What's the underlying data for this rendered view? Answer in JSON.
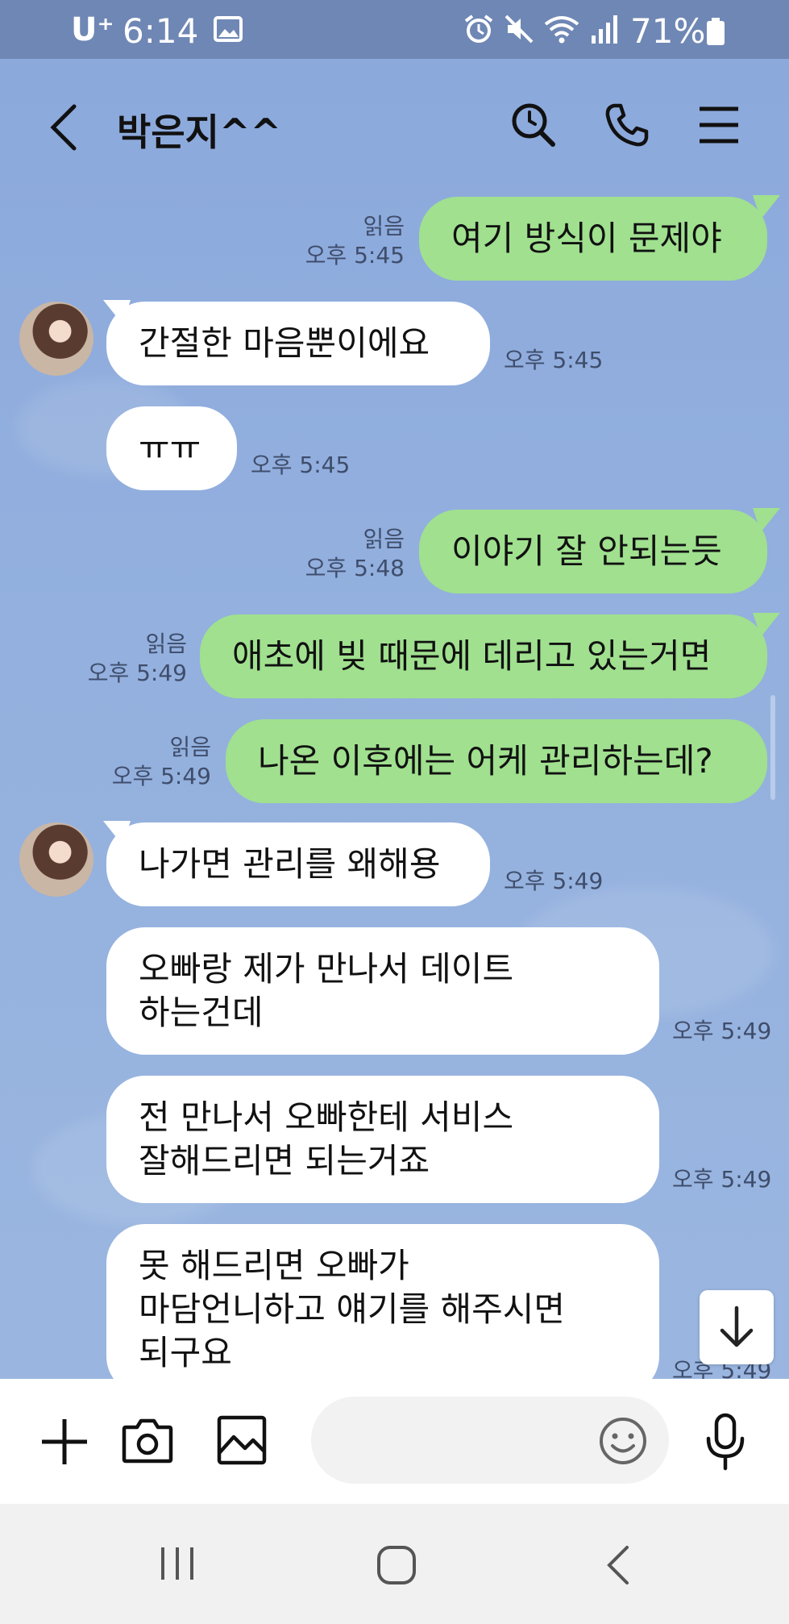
{
  "status_bar": {
    "carrier": "U⁺",
    "time": "6:14",
    "battery": "71%"
  },
  "header": {
    "title": "박은지^^"
  },
  "messages": [
    {
      "dir": "out",
      "text": "여기 방식이 문제야",
      "read": "읽음",
      "time": "오후 5:45"
    },
    {
      "dir": "in",
      "text": "간절한 마음뿐이에요",
      "time": "오후 5:45"
    },
    {
      "dir": "in",
      "text": "ㅠㅠ",
      "time": "오후 5:45"
    },
    {
      "dir": "out",
      "text": "이야기 잘 안되는듯",
      "read": "읽음",
      "time": "오후 5:48"
    },
    {
      "dir": "out",
      "text": "애초에 빚 때문에 데리고 있는거면",
      "read": "읽음",
      "time": "오후 5:49"
    },
    {
      "dir": "out",
      "text": "나온 이후에는 어케 관리하는데?",
      "read": "읽음",
      "time": "오후 5:49"
    },
    {
      "dir": "in",
      "text": "나가면 관리를 왜해용",
      "time": "오후 5:49"
    },
    {
      "dir": "in",
      "line1": "오빠랑 제가 만나서 데이트",
      "line2": "하는건데",
      "time": "오후 5:49"
    },
    {
      "dir": "in",
      "line1": "전 만나서 오빠한테 서비스",
      "line2": "잘해드리면 되는거죠",
      "time": "오후 5:49"
    },
    {
      "dir": "in",
      "line1": "못 해드리면 오빠가",
      "line2": "마담언니하고 얘기를 해주시면",
      "line3": "되구요",
      "time": "오후 5:49"
    }
  ],
  "input": {
    "placeholder": ""
  }
}
